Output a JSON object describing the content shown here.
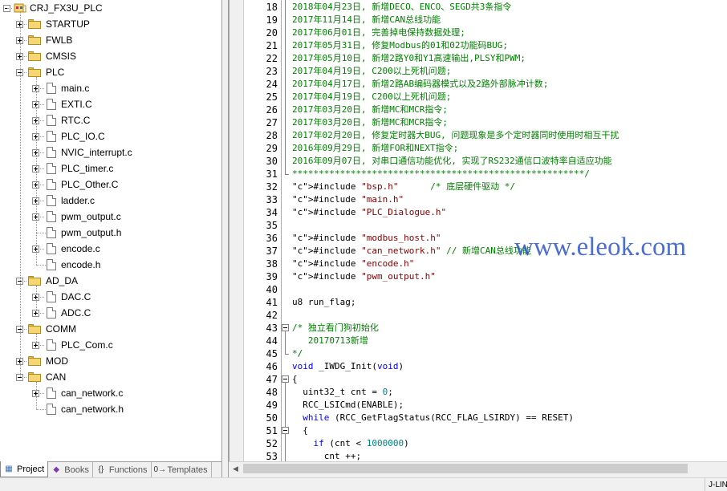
{
  "project": {
    "root": "CRJ_FX3U_PLC",
    "groups": [
      {
        "name": "STARTUP",
        "expanded": false,
        "files": []
      },
      {
        "name": "FWLB",
        "expanded": false,
        "files": []
      },
      {
        "name": "CMSIS",
        "expanded": false,
        "files": []
      },
      {
        "name": "PLC",
        "expanded": true,
        "files": [
          {
            "name": "main.c",
            "expandable": true
          },
          {
            "name": "EXTI.C",
            "expandable": true
          },
          {
            "name": "RTC.C",
            "expandable": true
          },
          {
            "name": "PLC_IO.C",
            "expandable": true
          },
          {
            "name": "NVIC_interrupt.c",
            "expandable": true
          },
          {
            "name": "PLC_timer.c",
            "expandable": true
          },
          {
            "name": "PLC_Other.C",
            "expandable": true
          },
          {
            "name": "ladder.c",
            "expandable": true
          },
          {
            "name": "pwm_output.c",
            "expandable": true
          },
          {
            "name": "pwm_output.h",
            "expandable": false
          },
          {
            "name": "encode.c",
            "expandable": true
          },
          {
            "name": "encode.h",
            "expandable": false
          }
        ]
      },
      {
        "name": "AD_DA",
        "expanded": true,
        "files": [
          {
            "name": "DAC.C",
            "expandable": true
          },
          {
            "name": "ADC.C",
            "expandable": true
          }
        ]
      },
      {
        "name": "COMM",
        "expanded": true,
        "files": [
          {
            "name": "PLC_Com.c",
            "expandable": true
          }
        ]
      },
      {
        "name": "MOD",
        "expanded": false,
        "files": []
      },
      {
        "name": "CAN",
        "expanded": true,
        "files": [
          {
            "name": "can_network.c",
            "expandable": true
          },
          {
            "name": "can_network.h",
            "expandable": false
          }
        ]
      }
    ]
  },
  "tabs": [
    {
      "label": "Project",
      "icon": "project-icon",
      "active": true
    },
    {
      "label": "Books",
      "icon": "books-icon",
      "active": false
    },
    {
      "label": "Functions",
      "icon": "functions-icon",
      "active": false
    },
    {
      "label": "Templates",
      "icon": "templates-icon",
      "active": false
    }
  ],
  "editor": {
    "lines": [
      {
        "n": "18",
        "text": "2018年04月23日, 新增DECO、ENCO、SEGD共3条指令"
      },
      {
        "n": "19",
        "text": "2017年11月14日, 新增CAN总线功能"
      },
      {
        "n": "20",
        "text": "2017年06月01日, 完善掉电保持数据处理;"
      },
      {
        "n": "21",
        "text": "2017年05月31日, 修复Modbus的01和02功能码BUG;"
      },
      {
        "n": "22",
        "text": "2017年05月10日, 新增2路Y0和Y1高速输出,PLSY和PWM;"
      },
      {
        "n": "23",
        "text": "2017年04月19日, C200以上死机问题;"
      },
      {
        "n": "24",
        "text": "2017年04月17日, 新增2路AB编码器模式以及2路外部脉冲计数;"
      },
      {
        "n": "25",
        "text": "2017年04月19日, C200以上死机问题;"
      },
      {
        "n": "26",
        "text": "2017年03月20日, 新增MC和MCR指令;"
      },
      {
        "n": "27",
        "text": "2017年03月20日, 新增MC和MCR指令;"
      },
      {
        "n": "28",
        "text": "2017年02月20日, 修复定时器大BUG, 问题现象是多个定时器同时使用时相互干扰"
      },
      {
        "n": "29",
        "text": "2016年09月29日, 新增FOR和NEXT指令;"
      },
      {
        "n": "30",
        "text": "2016年09月07日, 对串口通信功能优化, 实现了RS232通信口波特率自适应功能"
      },
      {
        "n": "31",
        "text": "*******************************************************/"
      },
      {
        "n": "32",
        "text": "#include \"bsp.h\"      /* 底层硬件驱动 */"
      },
      {
        "n": "33",
        "text": "#include \"main.h\""
      },
      {
        "n": "34",
        "text": "#include \"PLC_Dialogue.h\""
      },
      {
        "n": "35",
        "text": ""
      },
      {
        "n": "36",
        "text": "#include \"modbus_host.h\""
      },
      {
        "n": "37",
        "text": "#include \"can_network.h\" // 新增CAN总线功能"
      },
      {
        "n": "38",
        "text": "#include \"encode.h\""
      },
      {
        "n": "39",
        "text": "#include \"pwm_output.h\""
      },
      {
        "n": "40",
        "text": ""
      },
      {
        "n": "41",
        "text": "u8 run_flag;"
      },
      {
        "n": "42",
        "text": ""
      },
      {
        "n": "43",
        "text": "/* 独立看门狗初始化"
      },
      {
        "n": "44",
        "text": "   20170713新增"
      },
      {
        "n": "45",
        "text": "*/"
      },
      {
        "n": "46",
        "text": "void _IWDG_Init(void)"
      },
      {
        "n": "47",
        "text": "{"
      },
      {
        "n": "48",
        "text": "  uint32_t cnt = 0;"
      },
      {
        "n": "49",
        "text": "  RCC_LSICmd(ENABLE);"
      },
      {
        "n": "50",
        "text": "  while (RCC_GetFlagStatus(RCC_FLAG_LSIRDY) == RESET)"
      },
      {
        "n": "51",
        "text": "  {"
      },
      {
        "n": "52",
        "text": "    if (cnt < 1000000)"
      },
      {
        "n": "53",
        "text": "      cnt ++;"
      }
    ]
  },
  "watermark": "www.eleok.com",
  "status": {
    "debugger": "J-LIN"
  },
  "colors": {
    "comment": "#008000",
    "keyword": "#0000ff",
    "number": "#008080",
    "string": "#800000",
    "watermark": "#2d55c8"
  }
}
